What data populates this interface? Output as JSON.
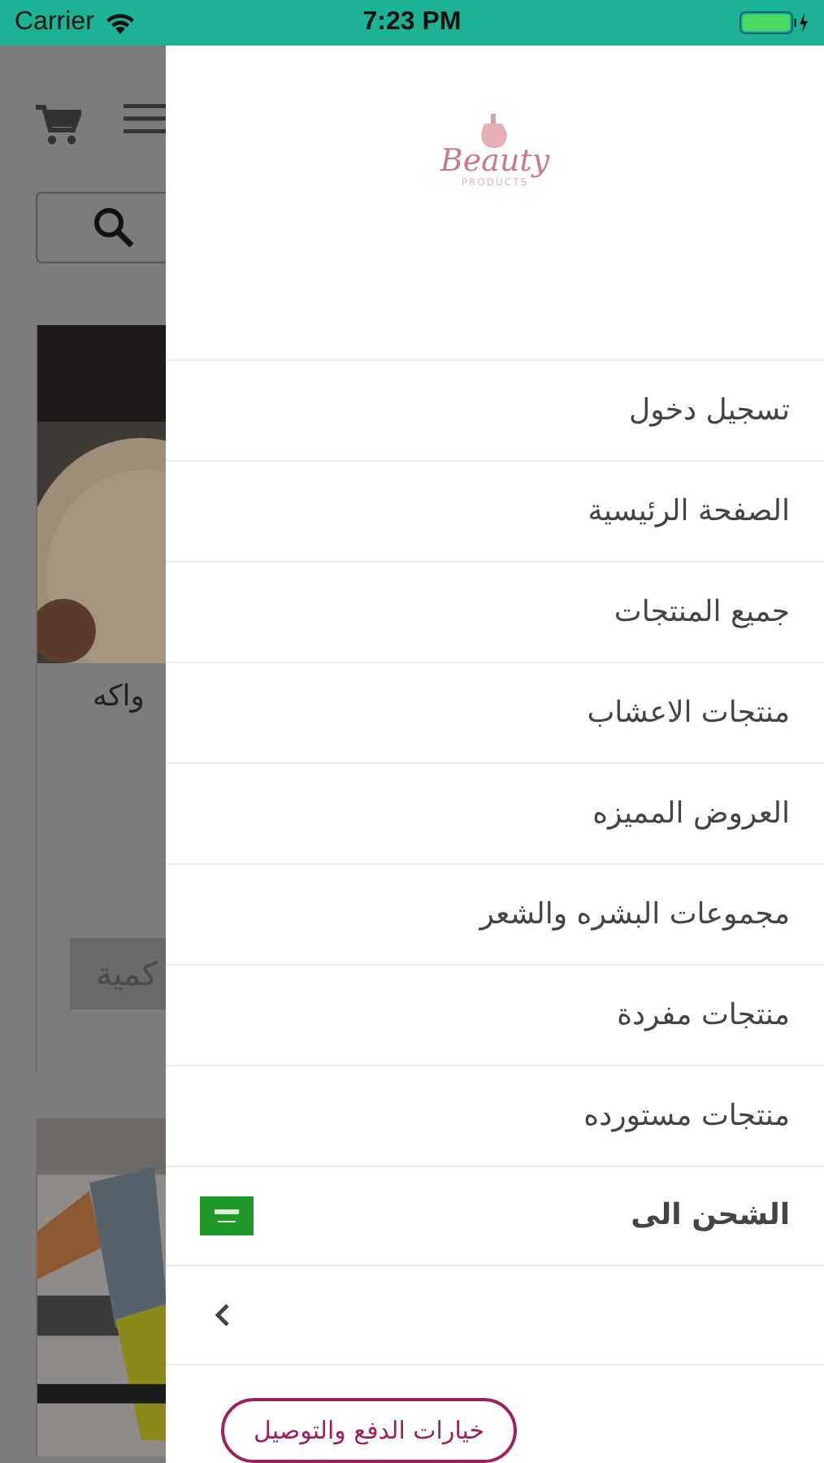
{
  "status_bar": {
    "carrier": "Carrier",
    "time": "7:23 PM"
  },
  "background_page": {
    "products": [
      {
        "kind": "picture",
        "title": "واكه",
        "quantity_button": "كمية"
      },
      {
        "kind": "picture"
      }
    ]
  },
  "drawer": {
    "logo": {
      "word": "Beauty",
      "subtitle": "PRODUCTS"
    },
    "menu_items": [
      {
        "label": "تسجيل دخول"
      },
      {
        "label": "الصفحة الرئيسية"
      },
      {
        "label": "جميع المنتجات"
      },
      {
        "label": "منتجات الاعشاب"
      },
      {
        "label": "العروض المميزه"
      },
      {
        "label": "مجموعات البشره والشعر"
      },
      {
        "label": "منتجات مفردة"
      },
      {
        "label": "منتجات مستورده"
      }
    ],
    "shipping": {
      "label": "الشحن الى"
    },
    "payment_button": "خيارات الدفع والتوصيل"
  }
}
